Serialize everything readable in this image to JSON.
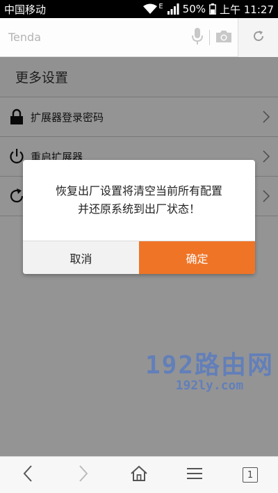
{
  "status_bar": {
    "carrier": "中国移动",
    "network_type": "E",
    "battery": "50%",
    "time": "上午 11:27"
  },
  "address_bar": {
    "url_text": "Tenda"
  },
  "page": {
    "title": "更多设置",
    "items": [
      {
        "label": "扩展器登录密码",
        "icon": "lock-icon"
      },
      {
        "label": "重启扩展器",
        "icon": "power-icon"
      },
      {
        "label": "",
        "icon": "reset-icon"
      }
    ]
  },
  "dialog": {
    "message_line1": "恢复出厂设置将清空当前所有配置",
    "message_line2": "并还原系统到出厂状态！",
    "cancel_label": "取消",
    "confirm_label": "确定",
    "confirm_color": "#ef7426"
  },
  "watermark": {
    "main": "192路由网",
    "sub": "192ly.com"
  },
  "bottom_bar": {
    "tab_count": "1"
  }
}
